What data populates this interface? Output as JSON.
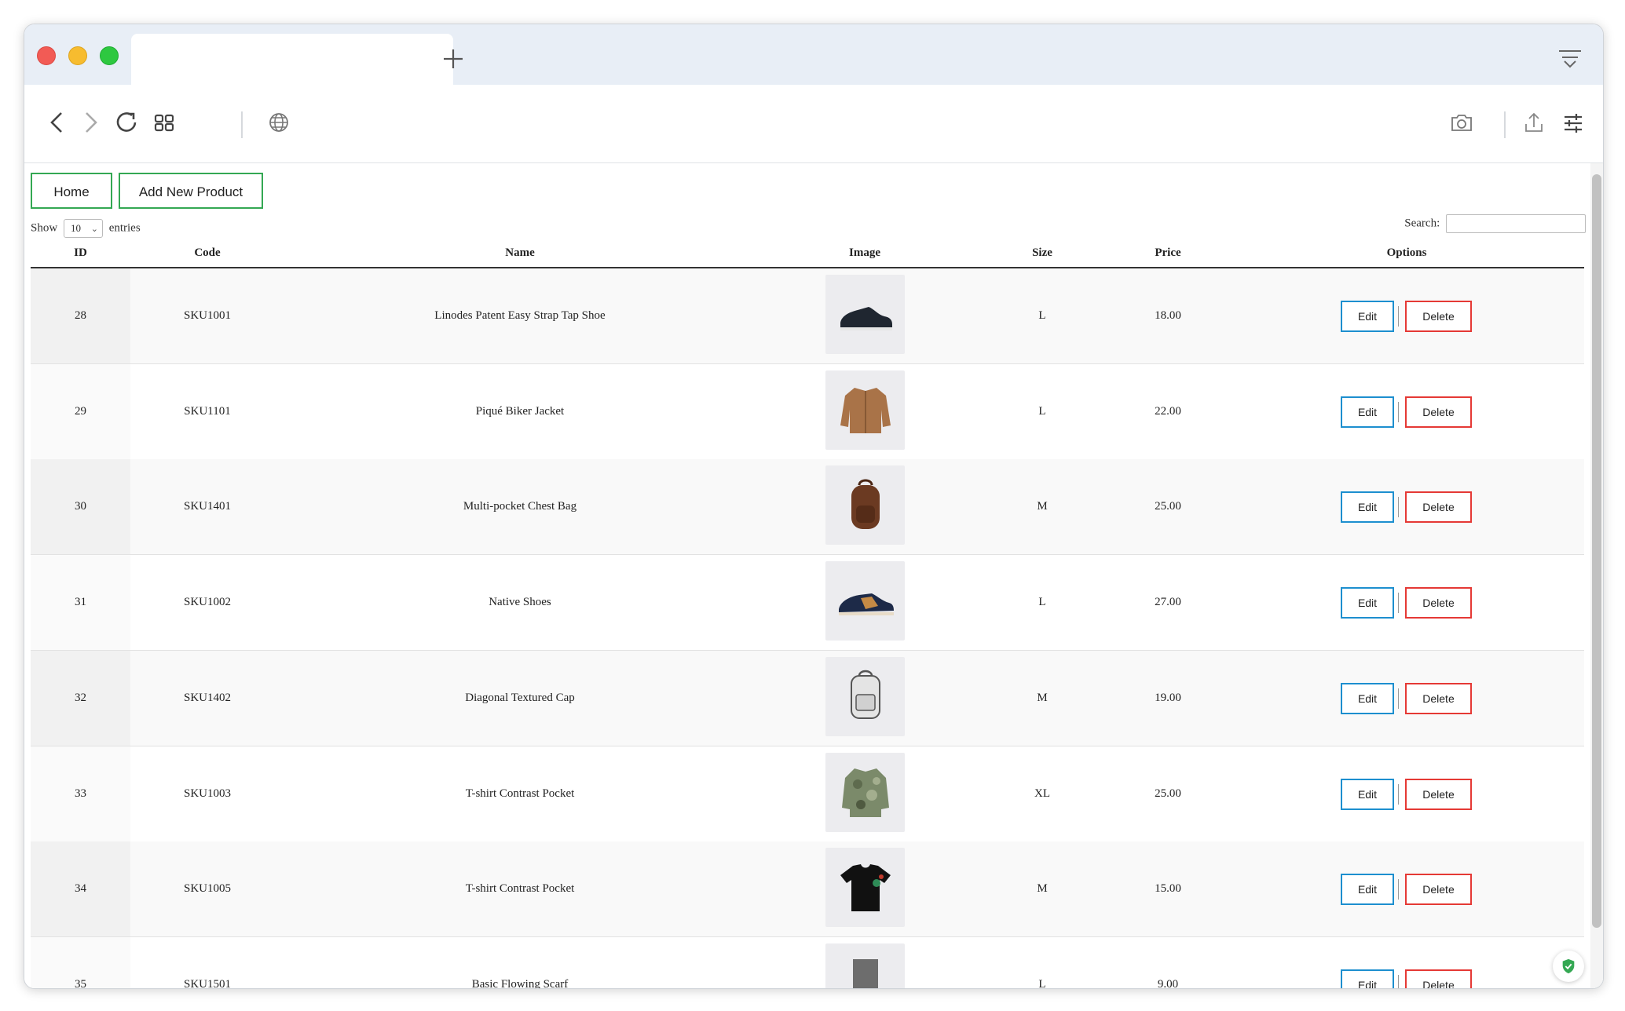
{
  "nav": {
    "home": "Home",
    "add_product": "Add New Product"
  },
  "table_controls": {
    "show_label": "Show",
    "entries_value": "10",
    "entries_label": "entries",
    "search_label": "Search:",
    "search_value": ""
  },
  "columns": [
    "ID",
    "Code",
    "Name",
    "Image",
    "Size",
    "Price",
    "Options"
  ],
  "buttons": {
    "edit": "Edit",
    "delete": "Delete"
  },
  "products": [
    {
      "id": "28",
      "code": "SKU1001",
      "name": "Linodes Patent Easy Strap Tap Shoe",
      "image": "dark-sneaker",
      "size": "L",
      "price": "18.00"
    },
    {
      "id": "29",
      "code": "SKU1101",
      "name": "Piqué Biker Jacket",
      "image": "tan-jacket",
      "size": "L",
      "price": "22.00"
    },
    {
      "id": "30",
      "code": "SKU1401",
      "name": "Multi-pocket Chest Bag",
      "image": "brown-backpack",
      "size": "M",
      "price": "25.00"
    },
    {
      "id": "31",
      "code": "SKU1002",
      "name": "Native Shoes",
      "image": "navy-tan-sneaker",
      "size": "L",
      "price": "27.00"
    },
    {
      "id": "32",
      "code": "SKU1402",
      "name": "Diagonal Textured Cap",
      "image": "white-backpack",
      "size": "M",
      "price": "19.00"
    },
    {
      "id": "33",
      "code": "SKU1003",
      "name": "T-shirt Contrast Pocket",
      "image": "camo-jacket",
      "size": "XL",
      "price": "25.00"
    },
    {
      "id": "34",
      "code": "SKU1005",
      "name": "T-shirt Contrast Pocket",
      "image": "black-tshirt",
      "size": "M",
      "price": "15.00"
    },
    {
      "id": "35",
      "code": "SKU1501",
      "name": "Basic Flowing Scarf",
      "image": "grey-scarf",
      "size": "L",
      "price": "9.00"
    }
  ],
  "colors": {
    "nav_border": "#34a853",
    "edit_border": "#1d8fcf",
    "delete_border": "#e53935",
    "tabbar_bg": "#e8eef6"
  }
}
